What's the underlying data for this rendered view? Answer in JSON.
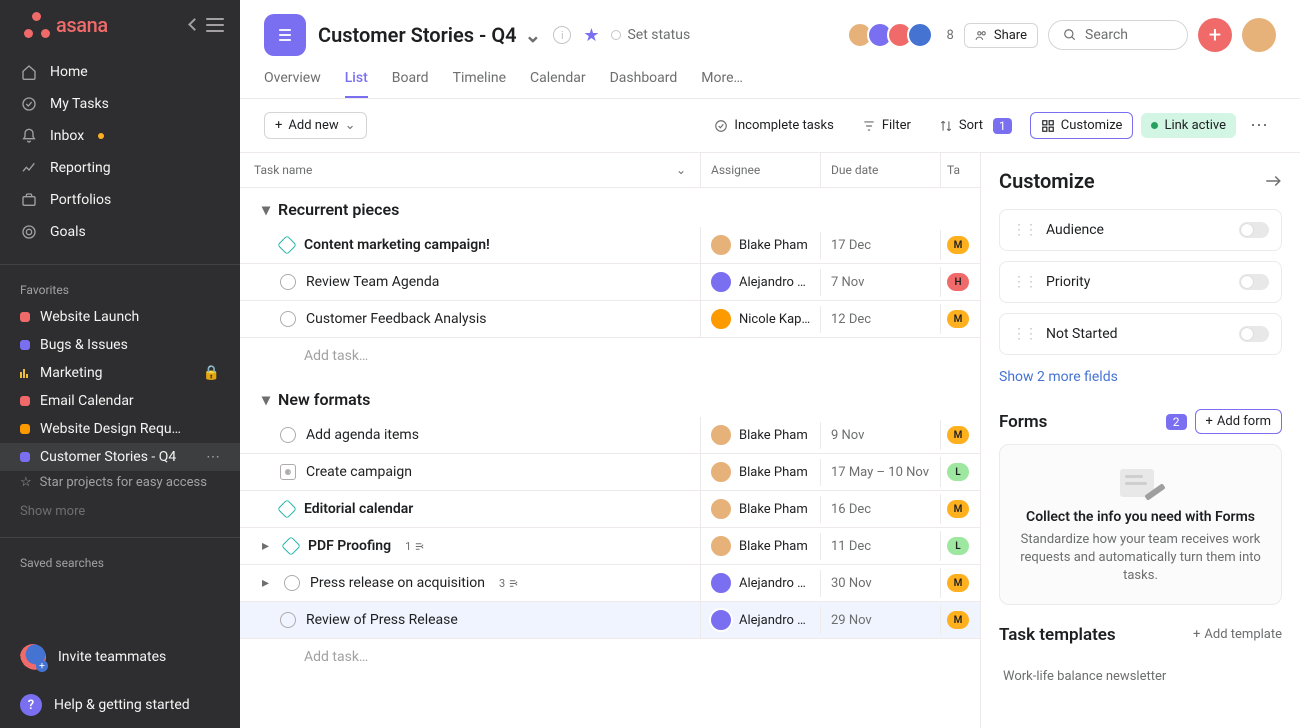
{
  "brand": "asana",
  "sidebar": {
    "nav": [
      {
        "label": "Home"
      },
      {
        "label": "My Tasks"
      },
      {
        "label": "Inbox",
        "badge": true
      },
      {
        "label": "Reporting"
      },
      {
        "label": "Portfolios"
      },
      {
        "label": "Goals"
      }
    ],
    "favorites_label": "Favorites",
    "favorites": [
      {
        "label": "Website Launch",
        "color": "#f06a6a"
      },
      {
        "label": "Bugs & Issues",
        "color": "#7a6ff0"
      },
      {
        "label": "Marketing",
        "color": "#f1bd37",
        "locked": true,
        "bar": true
      },
      {
        "label": "Email Calendar",
        "color": "#f06a6a"
      },
      {
        "label": "Website Design Requ…",
        "color": "#fd9a00"
      },
      {
        "label": "Customer Stories - Q4",
        "color": "#7a6ff0",
        "active": true
      }
    ],
    "star_hint": "Star projects for easy access",
    "show_more": "Show more",
    "saved_searches": "Saved searches",
    "invite": "Invite teammates",
    "help": "Help & getting started"
  },
  "header": {
    "title": "Customer Stories - Q4",
    "set_status": "Set status",
    "member_count": "8",
    "share": "Share",
    "search_placeholder": "Search"
  },
  "tabs": [
    "Overview",
    "List",
    "Board",
    "Timeline",
    "Calendar",
    "Dashboard",
    "More…"
  ],
  "active_tab": 1,
  "toolbar": {
    "add_new": "Add new",
    "incomplete": "Incomplete tasks",
    "filter": "Filter",
    "sort": "Sort",
    "sort_badge": "1",
    "customize": "Customize",
    "link_active": "Link active"
  },
  "columns": {
    "task": "Task name",
    "assignee": "Assignee",
    "due": "Due date",
    "tag": "Ta"
  },
  "sections": [
    {
      "name": "Recurrent pieces",
      "tasks": [
        {
          "name": "Content marketing campaign!",
          "bold": true,
          "icon": "diamond",
          "assignee": "Blake Pham",
          "av": "#e7b27a",
          "due": "17 Dec",
          "chip": "M",
          "chipColor": "#ffb01f"
        },
        {
          "name": "Review Team Agenda",
          "icon": "check",
          "assignee": "Alejandro L…",
          "av": "#7a6ff0",
          "due": "7 Nov",
          "chip": "H",
          "chipColor": "#f06a6a"
        },
        {
          "name": "Customer Feedback Analysis",
          "icon": "check",
          "assignee": "Nicole Kap…",
          "av": "#fd9a00",
          "due": "12 Dec",
          "chip": "M",
          "chipColor": "#ffb01f"
        }
      ],
      "add_task": "Add task…"
    },
    {
      "name": "New formats",
      "tasks": [
        {
          "name": "Add agenda items",
          "icon": "check",
          "assignee": "Blake Pham",
          "av": "#e7b27a",
          "due": "9 Nov",
          "chip": "M",
          "chipColor": "#ffb01f"
        },
        {
          "name": "Create campaign",
          "icon": "people",
          "assignee": "Blake Pham",
          "av": "#e7b27a",
          "due": "17 May – 10 Nov",
          "chip": "L",
          "chipColor": "#9ee7a0"
        },
        {
          "name": "Editorial calendar",
          "bold": true,
          "icon": "diamond",
          "assignee": "Blake Pham",
          "av": "#e7b27a",
          "due": "16 Dec",
          "chip": "M",
          "chipColor": "#ffb01f"
        },
        {
          "name": "PDF Proofing",
          "bold": true,
          "icon": "diamond",
          "assignee": "Blake Pham",
          "av": "#e7b27a",
          "due": "11 Dec",
          "chip": "L",
          "chipColor": "#9ee7a0",
          "expand": true,
          "sub": "1"
        },
        {
          "name": "Press release on acquisition",
          "icon": "check",
          "assignee": "Alejandro L…",
          "av": "#7a6ff0",
          "due": "30 Nov",
          "chip": "M",
          "chipColor": "#ffb01f",
          "expand": true,
          "sub": "3"
        },
        {
          "name": "Review of Press Release",
          "icon": "check",
          "assignee": "Alejandro L…",
          "av": "#7a6ff0",
          "due": "29 Nov",
          "chip": "M",
          "chipColor": "#ffb01f",
          "selected": true
        }
      ],
      "add_task": "Add task…"
    }
  ],
  "panel": {
    "title": "Customize",
    "fields": [
      {
        "label": "Audience"
      },
      {
        "label": "Priority"
      },
      {
        "label": "Not Started"
      }
    ],
    "show_more": "Show 2 more fields",
    "forms_title": "Forms",
    "forms_badge": "2",
    "add_form": "Add form",
    "form_heading": "Collect the info you need with Forms",
    "form_desc": "Standardize how your team receives work requests and automatically turn them into tasks.",
    "templates_title": "Task templates",
    "add_template": "Add template",
    "template_row": "Work-life balance newsletter"
  },
  "avatar_colors": [
    "#e7b27a",
    "#7a6ff0",
    "#f06a6a",
    "#4573d2"
  ]
}
